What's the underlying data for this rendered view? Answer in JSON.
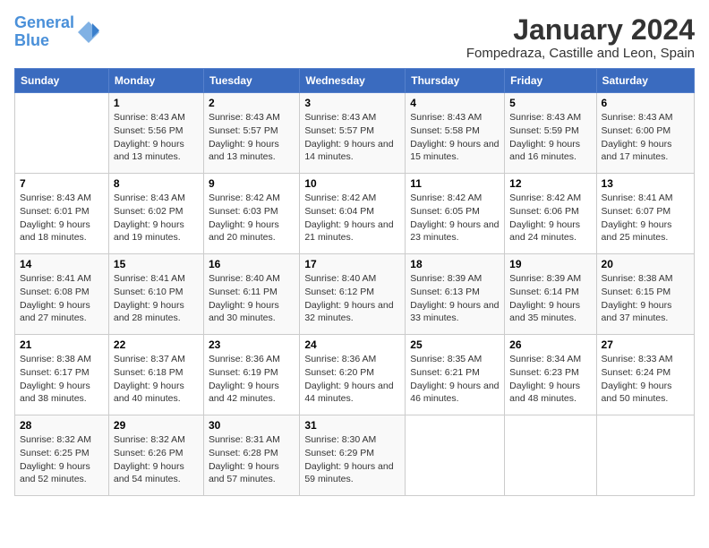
{
  "logo": {
    "text1": "General",
    "text2": "Blue"
  },
  "title": "January 2024",
  "subtitle": "Fompedraza, Castille and Leon, Spain",
  "days_of_week": [
    "Sunday",
    "Monday",
    "Tuesday",
    "Wednesday",
    "Thursday",
    "Friday",
    "Saturday"
  ],
  "weeks": [
    [
      {
        "day": "",
        "sunrise": "",
        "sunset": "",
        "daylight": ""
      },
      {
        "day": "1",
        "sunrise": "Sunrise: 8:43 AM",
        "sunset": "Sunset: 5:56 PM",
        "daylight": "Daylight: 9 hours and 13 minutes."
      },
      {
        "day": "2",
        "sunrise": "Sunrise: 8:43 AM",
        "sunset": "Sunset: 5:57 PM",
        "daylight": "Daylight: 9 hours and 13 minutes."
      },
      {
        "day": "3",
        "sunrise": "Sunrise: 8:43 AM",
        "sunset": "Sunset: 5:57 PM",
        "daylight": "Daylight: 9 hours and 14 minutes."
      },
      {
        "day": "4",
        "sunrise": "Sunrise: 8:43 AM",
        "sunset": "Sunset: 5:58 PM",
        "daylight": "Daylight: 9 hours and 15 minutes."
      },
      {
        "day": "5",
        "sunrise": "Sunrise: 8:43 AM",
        "sunset": "Sunset: 5:59 PM",
        "daylight": "Daylight: 9 hours and 16 minutes."
      },
      {
        "day": "6",
        "sunrise": "Sunrise: 8:43 AM",
        "sunset": "Sunset: 6:00 PM",
        "daylight": "Daylight: 9 hours and 17 minutes."
      }
    ],
    [
      {
        "day": "7",
        "sunrise": "Sunrise: 8:43 AM",
        "sunset": "Sunset: 6:01 PM",
        "daylight": "Daylight: 9 hours and 18 minutes."
      },
      {
        "day": "8",
        "sunrise": "Sunrise: 8:43 AM",
        "sunset": "Sunset: 6:02 PM",
        "daylight": "Daylight: 9 hours and 19 minutes."
      },
      {
        "day": "9",
        "sunrise": "Sunrise: 8:42 AM",
        "sunset": "Sunset: 6:03 PM",
        "daylight": "Daylight: 9 hours and 20 minutes."
      },
      {
        "day": "10",
        "sunrise": "Sunrise: 8:42 AM",
        "sunset": "Sunset: 6:04 PM",
        "daylight": "Daylight: 9 hours and 21 minutes."
      },
      {
        "day": "11",
        "sunrise": "Sunrise: 8:42 AM",
        "sunset": "Sunset: 6:05 PM",
        "daylight": "Daylight: 9 hours and 23 minutes."
      },
      {
        "day": "12",
        "sunrise": "Sunrise: 8:42 AM",
        "sunset": "Sunset: 6:06 PM",
        "daylight": "Daylight: 9 hours and 24 minutes."
      },
      {
        "day": "13",
        "sunrise": "Sunrise: 8:41 AM",
        "sunset": "Sunset: 6:07 PM",
        "daylight": "Daylight: 9 hours and 25 minutes."
      }
    ],
    [
      {
        "day": "14",
        "sunrise": "Sunrise: 8:41 AM",
        "sunset": "Sunset: 6:08 PM",
        "daylight": "Daylight: 9 hours and 27 minutes."
      },
      {
        "day": "15",
        "sunrise": "Sunrise: 8:41 AM",
        "sunset": "Sunset: 6:10 PM",
        "daylight": "Daylight: 9 hours and 28 minutes."
      },
      {
        "day": "16",
        "sunrise": "Sunrise: 8:40 AM",
        "sunset": "Sunset: 6:11 PM",
        "daylight": "Daylight: 9 hours and 30 minutes."
      },
      {
        "day": "17",
        "sunrise": "Sunrise: 8:40 AM",
        "sunset": "Sunset: 6:12 PM",
        "daylight": "Daylight: 9 hours and 32 minutes."
      },
      {
        "day": "18",
        "sunrise": "Sunrise: 8:39 AM",
        "sunset": "Sunset: 6:13 PM",
        "daylight": "Daylight: 9 hours and 33 minutes."
      },
      {
        "day": "19",
        "sunrise": "Sunrise: 8:39 AM",
        "sunset": "Sunset: 6:14 PM",
        "daylight": "Daylight: 9 hours and 35 minutes."
      },
      {
        "day": "20",
        "sunrise": "Sunrise: 8:38 AM",
        "sunset": "Sunset: 6:15 PM",
        "daylight": "Daylight: 9 hours and 37 minutes."
      }
    ],
    [
      {
        "day": "21",
        "sunrise": "Sunrise: 8:38 AM",
        "sunset": "Sunset: 6:17 PM",
        "daylight": "Daylight: 9 hours and 38 minutes."
      },
      {
        "day": "22",
        "sunrise": "Sunrise: 8:37 AM",
        "sunset": "Sunset: 6:18 PM",
        "daylight": "Daylight: 9 hours and 40 minutes."
      },
      {
        "day": "23",
        "sunrise": "Sunrise: 8:36 AM",
        "sunset": "Sunset: 6:19 PM",
        "daylight": "Daylight: 9 hours and 42 minutes."
      },
      {
        "day": "24",
        "sunrise": "Sunrise: 8:36 AM",
        "sunset": "Sunset: 6:20 PM",
        "daylight": "Daylight: 9 hours and 44 minutes."
      },
      {
        "day": "25",
        "sunrise": "Sunrise: 8:35 AM",
        "sunset": "Sunset: 6:21 PM",
        "daylight": "Daylight: 9 hours and 46 minutes."
      },
      {
        "day": "26",
        "sunrise": "Sunrise: 8:34 AM",
        "sunset": "Sunset: 6:23 PM",
        "daylight": "Daylight: 9 hours and 48 minutes."
      },
      {
        "day": "27",
        "sunrise": "Sunrise: 8:33 AM",
        "sunset": "Sunset: 6:24 PM",
        "daylight": "Daylight: 9 hours and 50 minutes."
      }
    ],
    [
      {
        "day": "28",
        "sunrise": "Sunrise: 8:32 AM",
        "sunset": "Sunset: 6:25 PM",
        "daylight": "Daylight: 9 hours and 52 minutes."
      },
      {
        "day": "29",
        "sunrise": "Sunrise: 8:32 AM",
        "sunset": "Sunset: 6:26 PM",
        "daylight": "Daylight: 9 hours and 54 minutes."
      },
      {
        "day": "30",
        "sunrise": "Sunrise: 8:31 AM",
        "sunset": "Sunset: 6:28 PM",
        "daylight": "Daylight: 9 hours and 57 minutes."
      },
      {
        "day": "31",
        "sunrise": "Sunrise: 8:30 AM",
        "sunset": "Sunset: 6:29 PM",
        "daylight": "Daylight: 9 hours and 59 minutes."
      },
      {
        "day": "",
        "sunrise": "",
        "sunset": "",
        "daylight": ""
      },
      {
        "day": "",
        "sunrise": "",
        "sunset": "",
        "daylight": ""
      },
      {
        "day": "",
        "sunrise": "",
        "sunset": "",
        "daylight": ""
      }
    ]
  ]
}
